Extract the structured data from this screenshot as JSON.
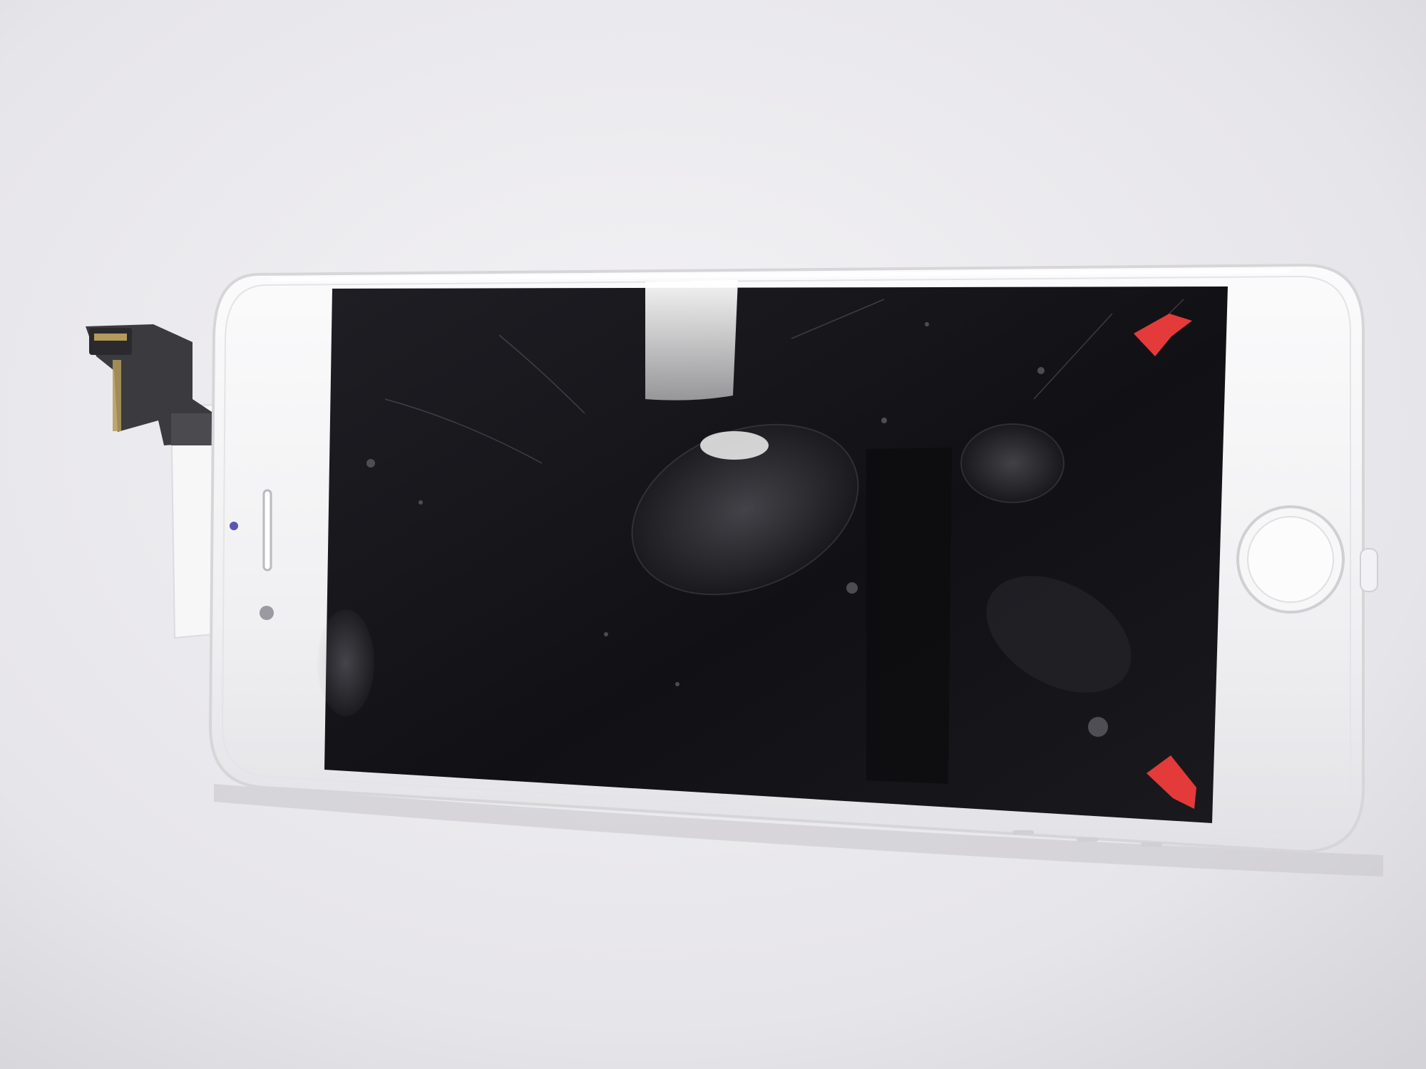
{
  "scene": {
    "subject": "iphone-screen-assembly",
    "colors": {
      "background": "#ecebee",
      "background_shade": "#d9d8dd",
      "frame": "#f4f4f5",
      "frame_edge": "#d6d6d9",
      "display": "#16161a",
      "flex_cable": "#3b3b3f",
      "connector": "#b49a5c",
      "protective_tab": "#e53a3a",
      "camera_dot": "#5b55b8",
      "sensor_dot": "#9a9aa0"
    },
    "icons": {
      "home_button": "home-button-ring",
      "earpiece": "earpiece-slot",
      "tabs": "red-arrow-tab"
    }
  }
}
